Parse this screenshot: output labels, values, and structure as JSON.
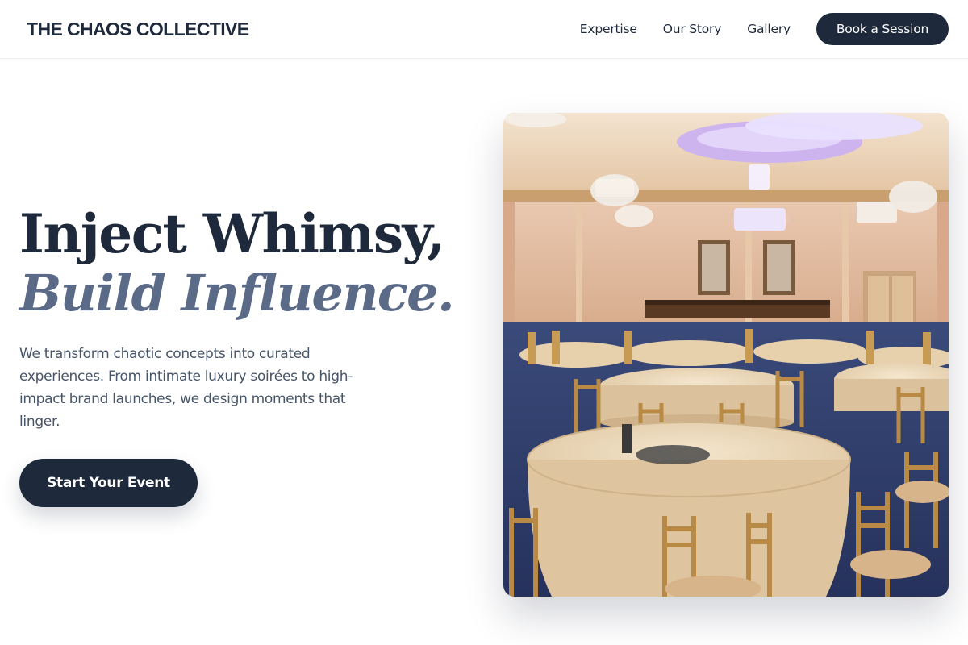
{
  "brand": {
    "name": "THE CHAOS COLLECTIVE"
  },
  "nav": {
    "links": [
      "Expertise",
      "Our Story",
      "Gallery"
    ],
    "cta_label": "Book a Session"
  },
  "hero": {
    "title_line1": "Inject Whimsy,",
    "title_line2": "Build Influence.",
    "description": "We transform chaotic concepts into curated experiences. From intimate luxury soirées to high-impact brand launches, we design moments that linger.",
    "cta_label": "Start Your Event",
    "image_alt": "Elegant ballroom with crystal chandeliers, round tables with gold damask tablecloths and gold chiavari chairs"
  },
  "colors": {
    "primary": "#1e293b",
    "accent_muted": "#5b6b87",
    "body_text": "#475569",
    "background": "#ffffff"
  }
}
